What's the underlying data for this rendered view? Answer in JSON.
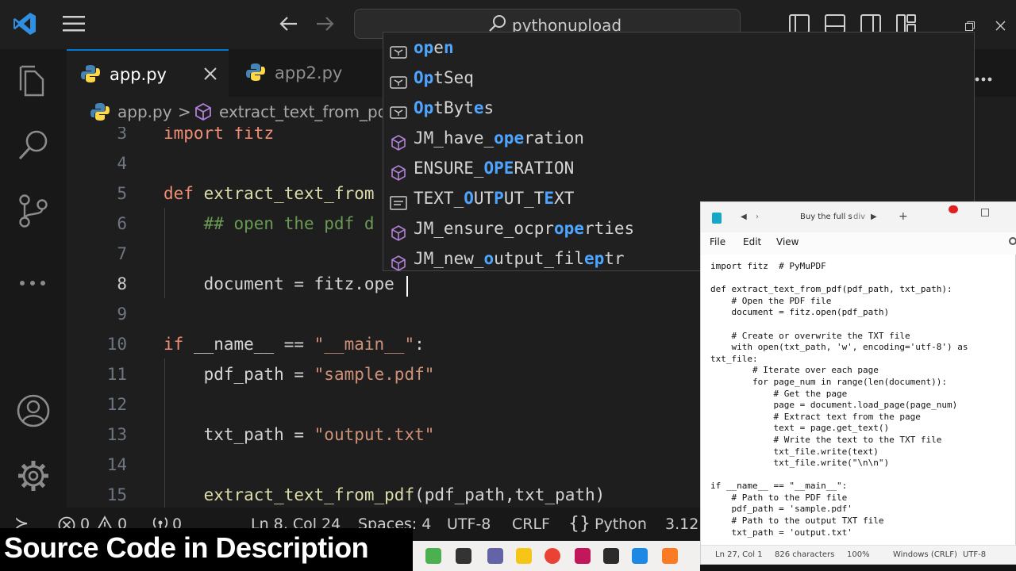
{
  "titlebar": {
    "search_text": "pythonupload"
  },
  "tabs": [
    {
      "label": "app.py",
      "close": "✕"
    },
    {
      "label": "app2.py"
    }
  ],
  "breadcrumb": {
    "file": "app.py",
    "separator": ">",
    "symbol": "extract_text_from_pd"
  },
  "editor": {
    "lines": [
      {
        "num": "3",
        "tokens": [
          {
            "t": "import ",
            "c": "kw"
          },
          {
            "t": "fitz",
            "c": "kw"
          }
        ]
      },
      {
        "num": "4",
        "tokens": []
      },
      {
        "num": "5",
        "tokens": [
          {
            "t": "def ",
            "c": "kw"
          },
          {
            "t": "extract_text_from",
            "c": "fn"
          }
        ]
      },
      {
        "num": "6",
        "tokens": [
          {
            "t": "    ## open the pdf d",
            "c": "cmt"
          }
        ]
      },
      {
        "num": "7",
        "tokens": []
      },
      {
        "num": "8",
        "tokens": [
          {
            "t": "    document = fitz.ope",
            "c": "var"
          }
        ]
      },
      {
        "num": "9",
        "tokens": []
      },
      {
        "num": "10",
        "tokens": [
          {
            "t": "if ",
            "c": "kw"
          },
          {
            "t": "__name__ == ",
            "c": "var"
          },
          {
            "t": "\"__main__\"",
            "c": "str"
          },
          {
            "t": ":",
            "c": "var"
          }
        ]
      },
      {
        "num": "11",
        "tokens": [
          {
            "t": "    pdf_path = ",
            "c": "var"
          },
          {
            "t": "\"sample.pdf\"",
            "c": "str"
          }
        ]
      },
      {
        "num": "12",
        "tokens": []
      },
      {
        "num": "13",
        "tokens": [
          {
            "t": "    txt_path = ",
            "c": "var"
          },
          {
            "t": "\"output.txt\"",
            "c": "str"
          }
        ]
      },
      {
        "num": "14",
        "tokens": []
      },
      {
        "num": "15",
        "tokens": [
          {
            "t": "    ",
            "c": "var"
          },
          {
            "t": "extract_text_from_pdf",
            "c": "fn"
          },
          {
            "t": "(pdf_path,txt_path)",
            "c": "var"
          }
        ]
      }
    ]
  },
  "suggestions": [
    {
      "kind": "variable",
      "parts": [
        [
          "op",
          true
        ],
        [
          "e",
          false
        ],
        [
          "n",
          true
        ]
      ]
    },
    {
      "kind": "variable",
      "parts": [
        [
          "Op",
          true
        ],
        [
          "tSeq",
          false
        ]
      ]
    },
    {
      "kind": "variable",
      "parts": [
        [
          "Op",
          true
        ],
        [
          "tByt",
          false
        ],
        [
          "e",
          true
        ],
        [
          "s",
          false
        ]
      ]
    },
    {
      "kind": "class",
      "parts": [
        [
          "JM_have_",
          false
        ],
        [
          "ope",
          true
        ],
        [
          "ration",
          false
        ]
      ]
    },
    {
      "kind": "class",
      "parts": [
        [
          "ENSURE_",
          false
        ],
        [
          "OPE",
          true
        ],
        [
          "RATION",
          false
        ]
      ]
    },
    {
      "kind": "text",
      "parts": [
        [
          "TEXT_",
          false
        ],
        [
          "O",
          true
        ],
        [
          "UT",
          false
        ],
        [
          "P",
          true
        ],
        [
          "UT_T",
          false
        ],
        [
          "E",
          true
        ],
        [
          "XT",
          false
        ]
      ]
    },
    {
      "kind": "class",
      "parts": [
        [
          "JM_ensure_ocpr",
          false
        ],
        [
          "ope",
          true
        ],
        [
          "rties",
          false
        ]
      ]
    },
    {
      "kind": "class",
      "parts": [
        [
          "JM_new_",
          false
        ],
        [
          "o",
          true
        ],
        [
          "utput_fil",
          false
        ],
        [
          "ep",
          true
        ],
        [
          "tr",
          false
        ]
      ]
    }
  ],
  "statusbar": {
    "remote": "≻",
    "errors": "0",
    "warnings": "0",
    "ports": "0",
    "position": "Ln 8, Col 24",
    "spaces": "Spaces: 4",
    "encoding": "UTF-8",
    "eol": "CRLF",
    "language": "Python",
    "version": "3.12."
  },
  "banner": {
    "text": "Source Code in  Description"
  },
  "notepad": {
    "tab_title": "Buy the full s",
    "tab_title2": "div",
    "menu": [
      "File",
      "Edit",
      "View"
    ],
    "content": "import fitz  # PyMuPDF\n\ndef extract_text_from_pdf(pdf_path, txt_path):\n    # Open the PDF file\n    document = fitz.open(pdf_path)\n\n    # Create or overwrite the TXT file\n    with open(txt_path, 'w', encoding='utf-8') as\ntxt_file:\n        # Iterate over each page\n        for page_num in range(len(document)):\n            # Get the page\n            page = document.load_page(page_num)\n            # Extract text from the page\n            text = page.get_text()\n            # Write the text to the TXT file\n            txt_file.write(text)\n            txt_file.write(\"\\n\\n\")\n\nif __name__ == \"__main__\":\n    # Path to the PDF file\n    pdf_path = 'sample.pdf'\n    # Path to the output TXT file\n    txt_path = 'output.txt'",
    "status": {
      "position": "Ln 27, Col 1",
      "chars": "826 characters",
      "zoom": "100%",
      "eol": "Windows (CRLF)",
      "encoding": "UTF-8"
    }
  },
  "colors": {
    "accent": "#0078d4",
    "highlight": "#4ea5ff",
    "keyword": "#f08d74",
    "string": "#ce9178",
    "function": "#dcdcaa"
  }
}
